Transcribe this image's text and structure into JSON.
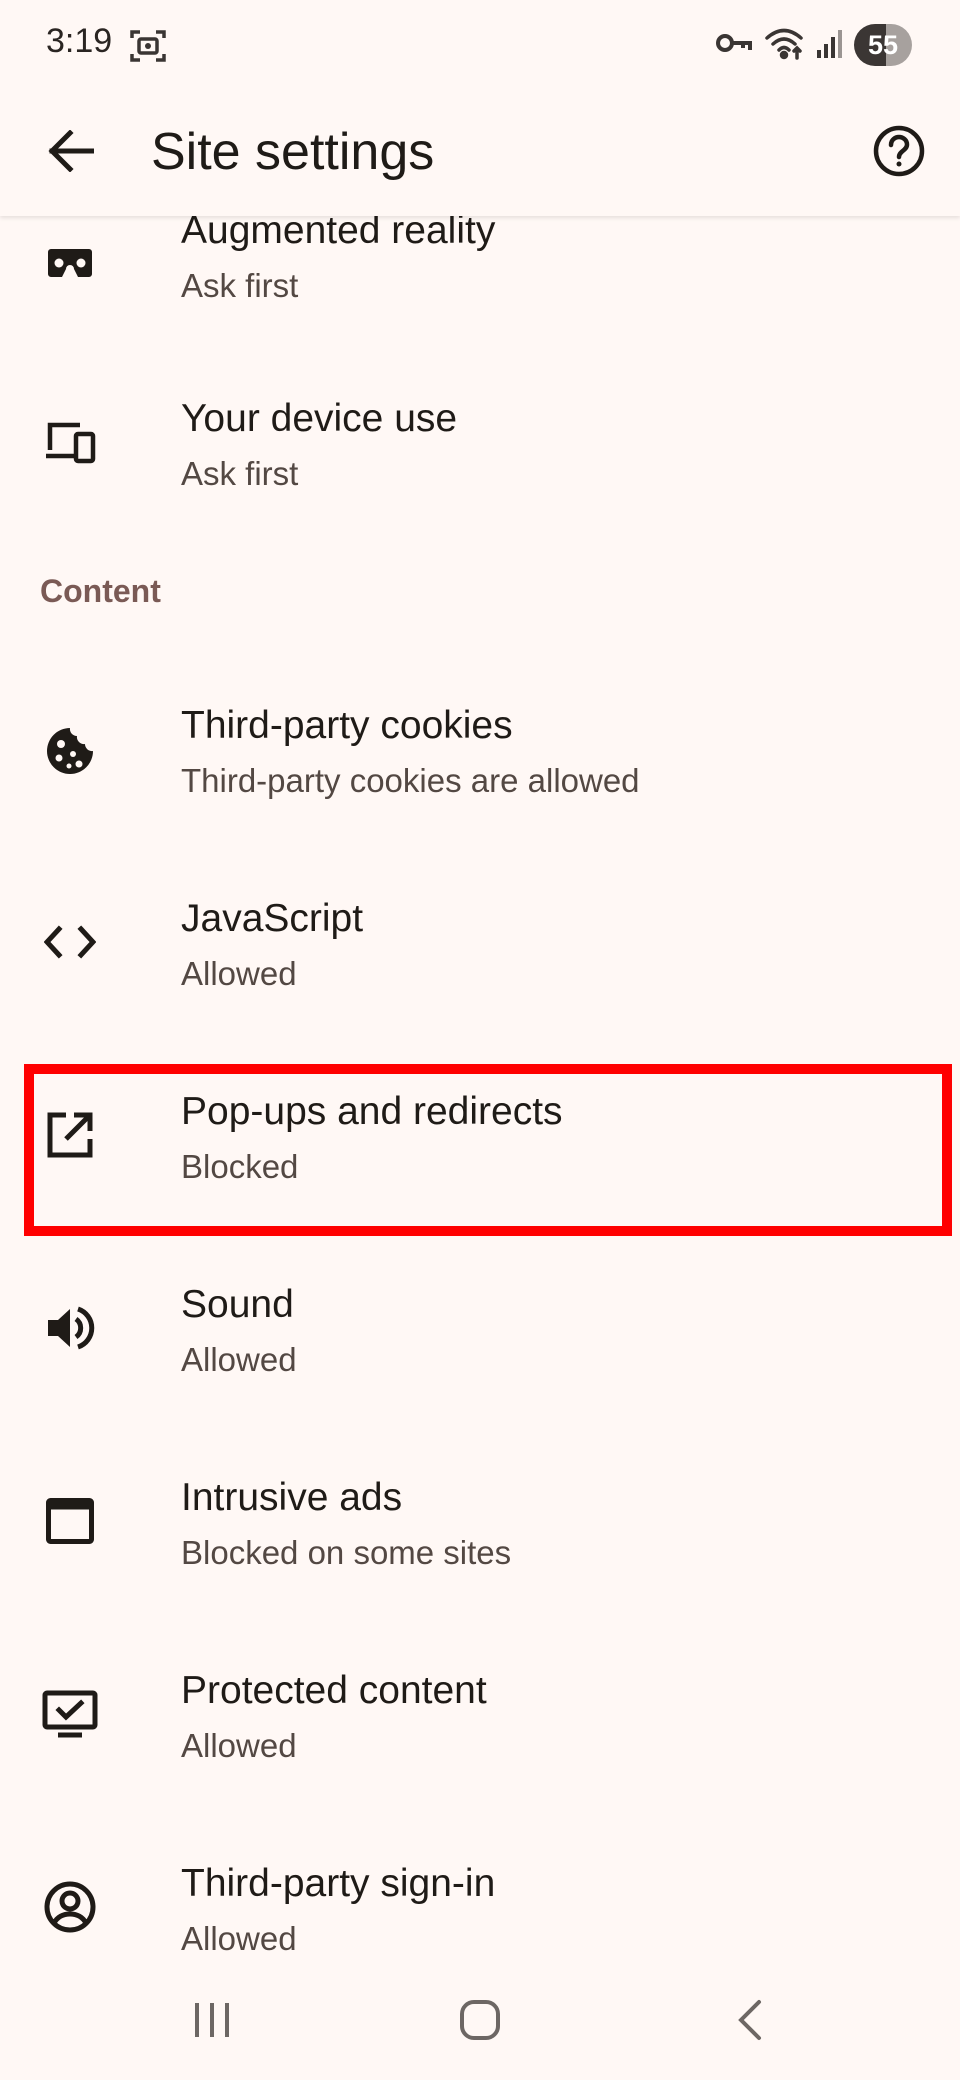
{
  "status_bar": {
    "time": "3:19",
    "battery": "55",
    "icons": [
      "screenshot-icon",
      "vpn-key-icon",
      "wifi-icon",
      "signal-icon"
    ]
  },
  "app_bar": {
    "title": "Site settings",
    "back_icon": "arrow-back-icon",
    "help_icon": "help-circle-icon"
  },
  "settings": {
    "top_items": [
      {
        "title": "Augmented reality",
        "subtitle": "Ask first",
        "icon": "vr-headset-icon"
      },
      {
        "title": "Your device use",
        "subtitle": "Ask first",
        "icon": "devices-icon"
      }
    ],
    "content_header": "Content",
    "content_items": [
      {
        "title": "Third-party cookies",
        "subtitle": "Third-party cookies are allowed",
        "icon": "cookie-icon"
      },
      {
        "title": "JavaScript",
        "subtitle": "Allowed",
        "icon": "code-icon"
      },
      {
        "title": "Pop-ups and redirects",
        "subtitle": "Blocked",
        "icon": "open-in-new-icon"
      },
      {
        "title": "Sound",
        "subtitle": "Allowed",
        "icon": "volume-icon"
      },
      {
        "title": "Intrusive ads",
        "subtitle": "Blocked on some sites",
        "icon": "ad-window-icon"
      },
      {
        "title": "Protected content",
        "subtitle": "Allowed",
        "icon": "protected-content-icon"
      },
      {
        "title": "Third-party sign-in",
        "subtitle": "Allowed",
        "icon": "account-circle-icon"
      }
    ]
  },
  "highlight": {
    "item": "Pop-ups and redirects",
    "color": "#ff0000"
  },
  "nav_bar": {
    "icons": [
      "recent-apps-icon",
      "home-icon",
      "back-icon"
    ]
  },
  "colors": {
    "background": "#fff8f5",
    "section_header": "#7a5a55",
    "text_primary": "#1f1b17",
    "text_secondary": "#534843"
  }
}
